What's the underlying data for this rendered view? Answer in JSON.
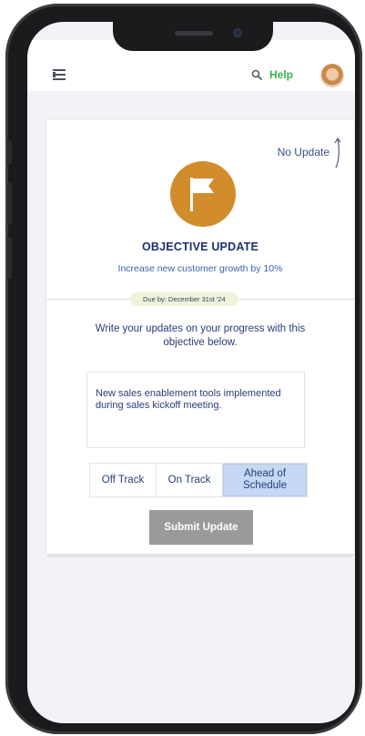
{
  "header": {
    "help_label": "Help",
    "icons": [
      "menu-icon",
      "search-icon",
      "avatar"
    ]
  },
  "objective": {
    "status": "No Update",
    "title": "OBJECTIVE UPDATE",
    "subtitle": "Increase new customer growth by 10%",
    "due": "Due by: December 31st '24",
    "instructions": "Write your updates on your progress with this objective below.",
    "update_text": "New sales enablement tools implemented during sales kickoff meeting.",
    "progress_options": [
      "Off Track",
      "On Track",
      "Ahead of Schedule"
    ],
    "selected_option": "Ahead of Schedule",
    "submit_label": "Submit Update"
  },
  "colors": {
    "accent": "#d18d2c",
    "primary_text": "#1e2f6e",
    "help_green": "#37b24d",
    "selected": "#c5d9f4",
    "submit_bg": "#9a9a9a"
  }
}
